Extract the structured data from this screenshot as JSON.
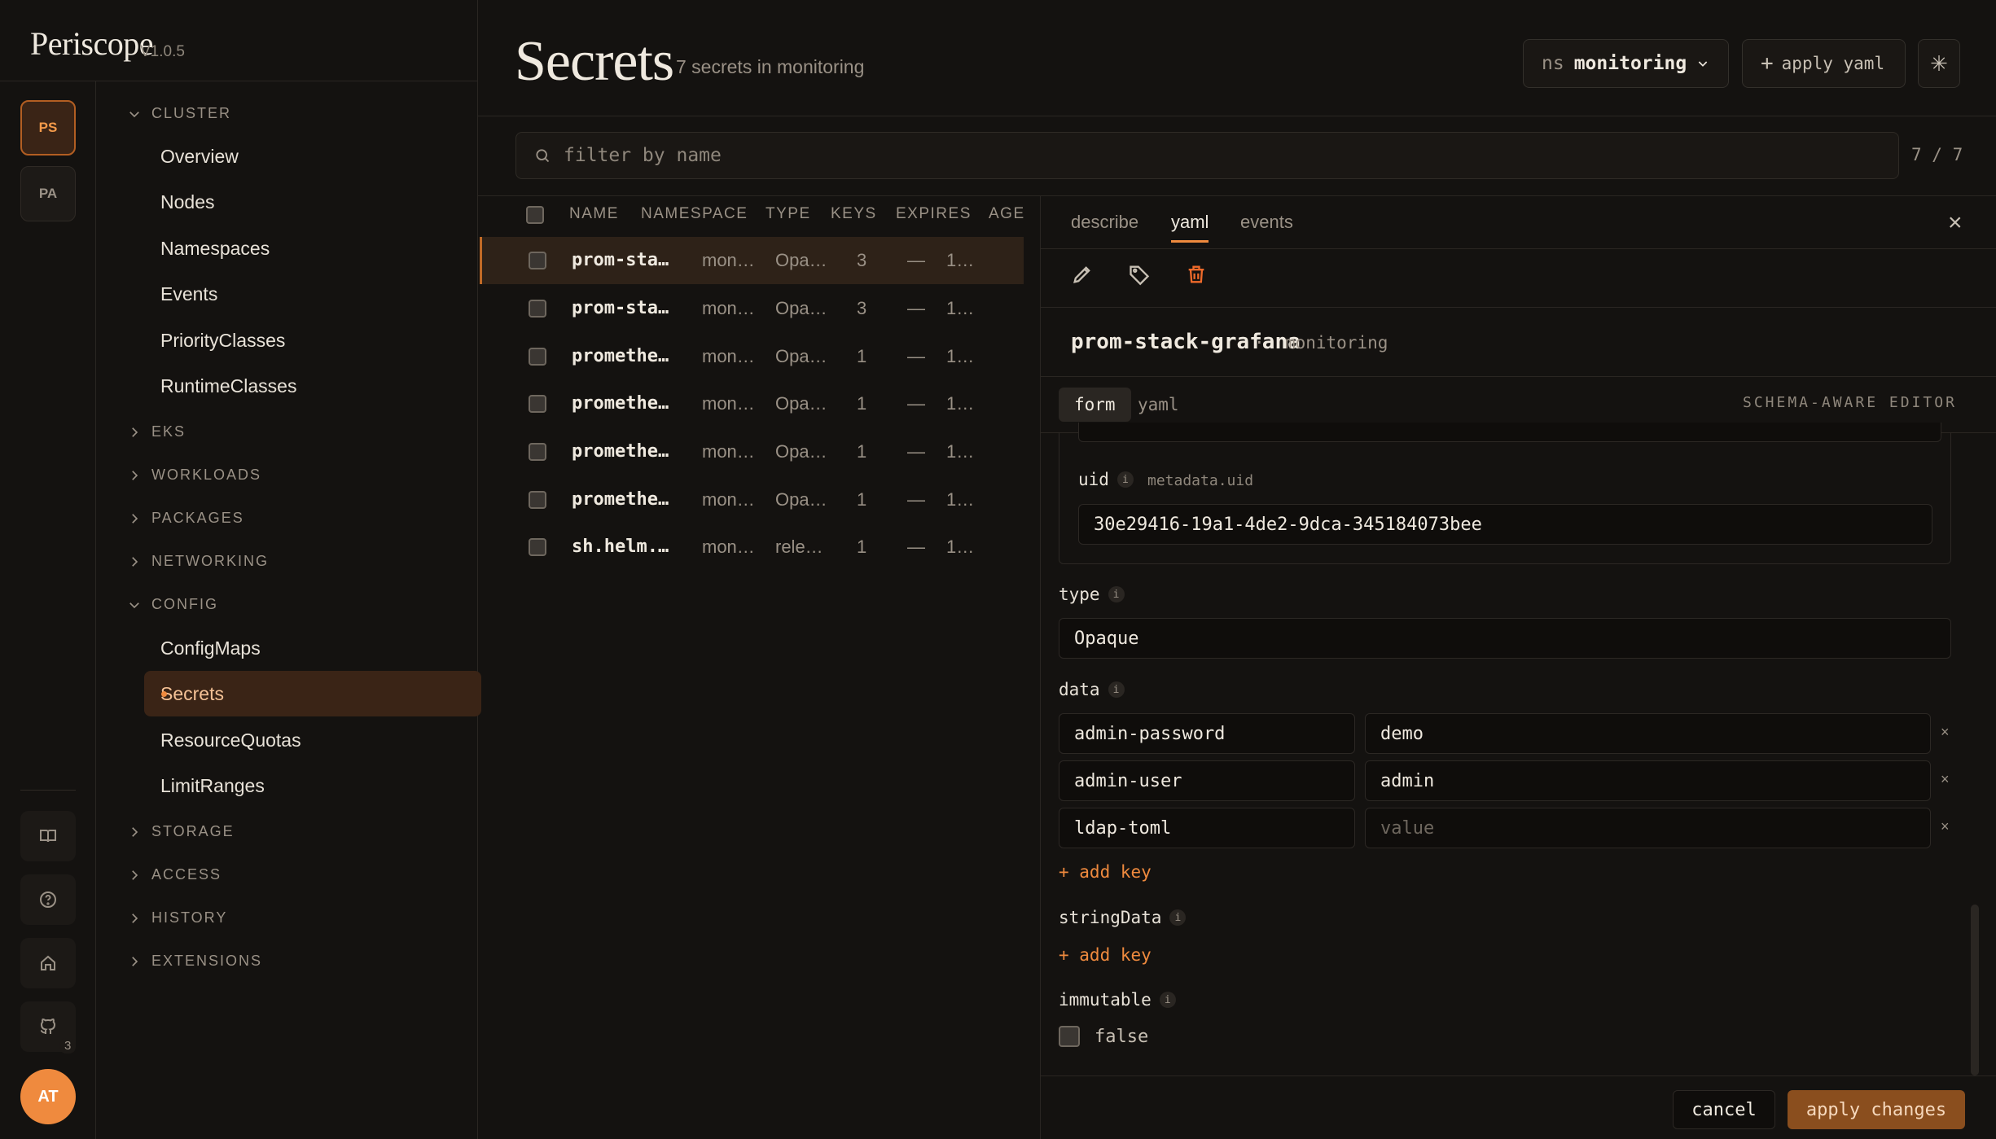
{
  "app": {
    "name": "Periscope",
    "version": "V1.0.5"
  },
  "accounts": [
    "PS",
    "PA"
  ],
  "rail": {
    "github_badge": "3",
    "user_initials": "AT"
  },
  "nav": {
    "cluster": {
      "label": "CLUSTER",
      "items": [
        "Overview",
        "Nodes",
        "Namespaces",
        "Events",
        "PriorityClasses",
        "RuntimeClasses"
      ]
    },
    "collapsed_a": [
      "EKS",
      "WORKLOADS",
      "PACKAGES",
      "NETWORKING"
    ],
    "config": {
      "label": "CONFIG",
      "items": [
        "ConfigMaps",
        "Secrets",
        "ResourceQuotas",
        "LimitRanges"
      ],
      "active": "Secrets"
    },
    "collapsed_b": [
      "STORAGE",
      "ACCESS",
      "HISTORY",
      "EXTENSIONS"
    ]
  },
  "header": {
    "title": "Secrets",
    "subtitle": "7 secrets in monitoring",
    "ns_label": "ns",
    "ns_value": "monitoring",
    "apply_label": "apply yaml"
  },
  "filter": {
    "placeholder": "filter by name",
    "count": "7 / 7"
  },
  "table": {
    "columns": [
      "NAME",
      "NAMESPACE",
      "TYPE",
      "KEYS",
      "EXPIRES",
      "AGE"
    ],
    "rows": [
      [
        "prom-sta…",
        "mon…",
        "Opa…",
        "3",
        "—",
        "1…"
      ],
      [
        "prom-sta…",
        "mon…",
        "Opa…",
        "3",
        "—",
        "1…"
      ],
      [
        "promethe…",
        "mon…",
        "Opa…",
        "1",
        "—",
        "1…"
      ],
      [
        "promethe…",
        "mon…",
        "Opa…",
        "1",
        "—",
        "1…"
      ],
      [
        "promethe…",
        "mon…",
        "Opa…",
        "1",
        "—",
        "1…"
      ],
      [
        "promethe…",
        "mon…",
        "Opa…",
        "1",
        "—",
        "1…"
      ],
      [
        "sh.helm.…",
        "mon…",
        "rele…",
        "1",
        "—",
        "1…"
      ]
    ]
  },
  "panel": {
    "tabs": [
      "describe",
      "yaml",
      "events"
    ],
    "active_tab": "yaml",
    "object_name": "prom-stack-grafana",
    "object_ns": "monitoring",
    "mode_tabs": [
      "form",
      "yaml"
    ],
    "schema_label": "SCHEMA-AWARE EDITOR",
    "uid": {
      "label": "uid",
      "path": "metadata.uid",
      "value": "30e29416-19a1-4de2-9dca-345184073bee"
    },
    "type": {
      "label": "type",
      "value": "Opaque"
    },
    "data": {
      "label": "data",
      "entries": [
        {
          "key": "admin-password",
          "value": "demo"
        },
        {
          "key": "admin-user",
          "value": "admin"
        },
        {
          "key": "ldap-toml",
          "value": ""
        }
      ],
      "value_placeholder": "value"
    },
    "add_key": "+ add key",
    "stringData": {
      "label": "stringData"
    },
    "immutable": {
      "label": "immutable",
      "value": "false"
    },
    "cancel": "cancel",
    "apply": "apply changes"
  }
}
